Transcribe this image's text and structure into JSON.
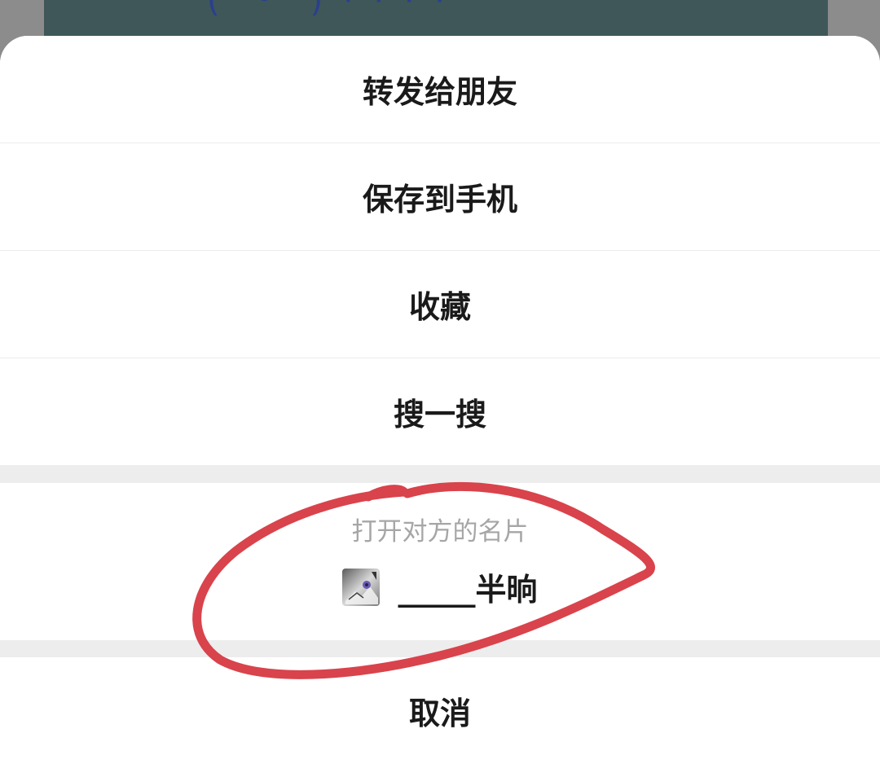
{
  "background": {
    "card_color": "#3f5758",
    "card_text": "(ᵔ ᵕ ᵔ) · ·  · ·"
  },
  "action_sheet": {
    "items": [
      {
        "label": "转发给朋友"
      },
      {
        "label": "保存到手机"
      },
      {
        "label": "收藏"
      },
      {
        "label": "搜一搜"
      }
    ],
    "profile_card": {
      "hint": "打开对方的名片",
      "name": "_____半晌",
      "avatar_icon": "landscape-photo-icon"
    },
    "cancel_label": "取消"
  },
  "annotation": {
    "shape": "hand-drawn-ellipse",
    "color": "#d9434c"
  }
}
